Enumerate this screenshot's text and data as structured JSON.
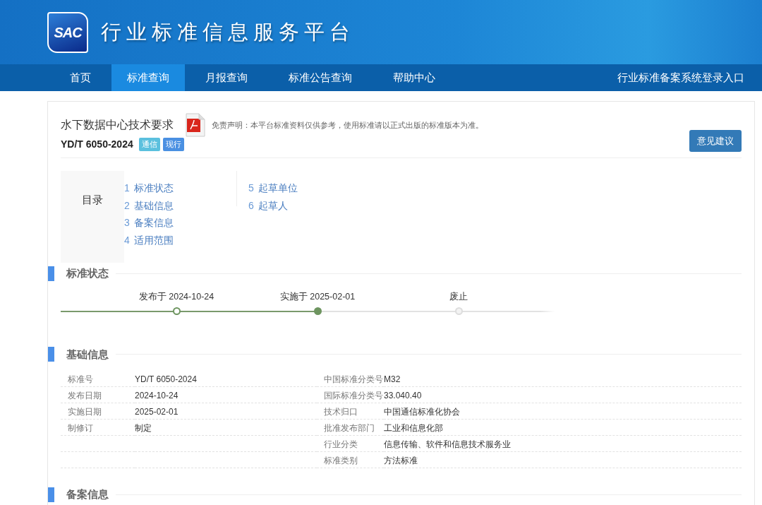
{
  "header": {
    "logo_text": "SAC",
    "site_title": "行业标准信息服务平台"
  },
  "nav": {
    "items": [
      {
        "label": "首页",
        "selected": false
      },
      {
        "label": "标准查询",
        "selected": true
      },
      {
        "label": "月报查询",
        "selected": false
      },
      {
        "label": "标准公告查询",
        "selected": false
      },
      {
        "label": "帮助中心",
        "selected": false
      }
    ],
    "login_link": "行业标准备案系统登录入口"
  },
  "standard": {
    "title": "水下数据中心技术要求",
    "disclaimer": "免责声明：本平台标准资料仅供参考，使用标准请以正式出版的标准版本为准。",
    "code": "YD/T 6050-2024",
    "tags": [
      {
        "label": "通信",
        "color": "#5bc0de"
      },
      {
        "label": "现行",
        "color": "#4a90e2"
      }
    ],
    "feedback_button": "意见建议"
  },
  "toc": {
    "title": "目录",
    "columns": [
      [
        {
          "number": "1",
          "label": "标准状态"
        },
        {
          "number": "2",
          "label": "基础信息"
        },
        {
          "number": "3",
          "label": "备案信息"
        },
        {
          "number": "4",
          "label": "适用范围"
        }
      ],
      [
        {
          "number": "5",
          "label": "起草单位"
        },
        {
          "number": "6",
          "label": "起草人"
        }
      ]
    ]
  },
  "status_section": {
    "heading": "标准状态",
    "steps": [
      {
        "label": "发布于 2024-10-24",
        "reached": true,
        "current": false
      },
      {
        "label": "实施于 2025-02-01",
        "reached": true,
        "current": true
      },
      {
        "label": "废止",
        "reached": false,
        "current": false
      }
    ]
  },
  "basic_section": {
    "heading": "基础信息",
    "rows": [
      {
        "left_label": "标准号",
        "left_value": "YD/T 6050-2024",
        "right_label": "中国标准分类号",
        "right_value": "M32"
      },
      {
        "left_label": "发布日期",
        "left_value": "2024-10-24",
        "right_label": "国际标准分类号",
        "right_value": "33.040.40"
      },
      {
        "left_label": "实施日期",
        "left_value": "2025-02-01",
        "right_label": "技术归口",
        "right_value": "中国通信标准化协会"
      },
      {
        "left_label": "制修订",
        "left_value": "制定",
        "right_label": "批准发布部门",
        "right_value": "工业和信息化部"
      },
      {
        "right_label": "行业分类",
        "right_value": "信息传输、软件和信息技术服务业"
      },
      {
        "right_label": "标准类别",
        "right_value": "方法标准"
      }
    ]
  },
  "filing_section": {
    "heading": "备案信息"
  }
}
